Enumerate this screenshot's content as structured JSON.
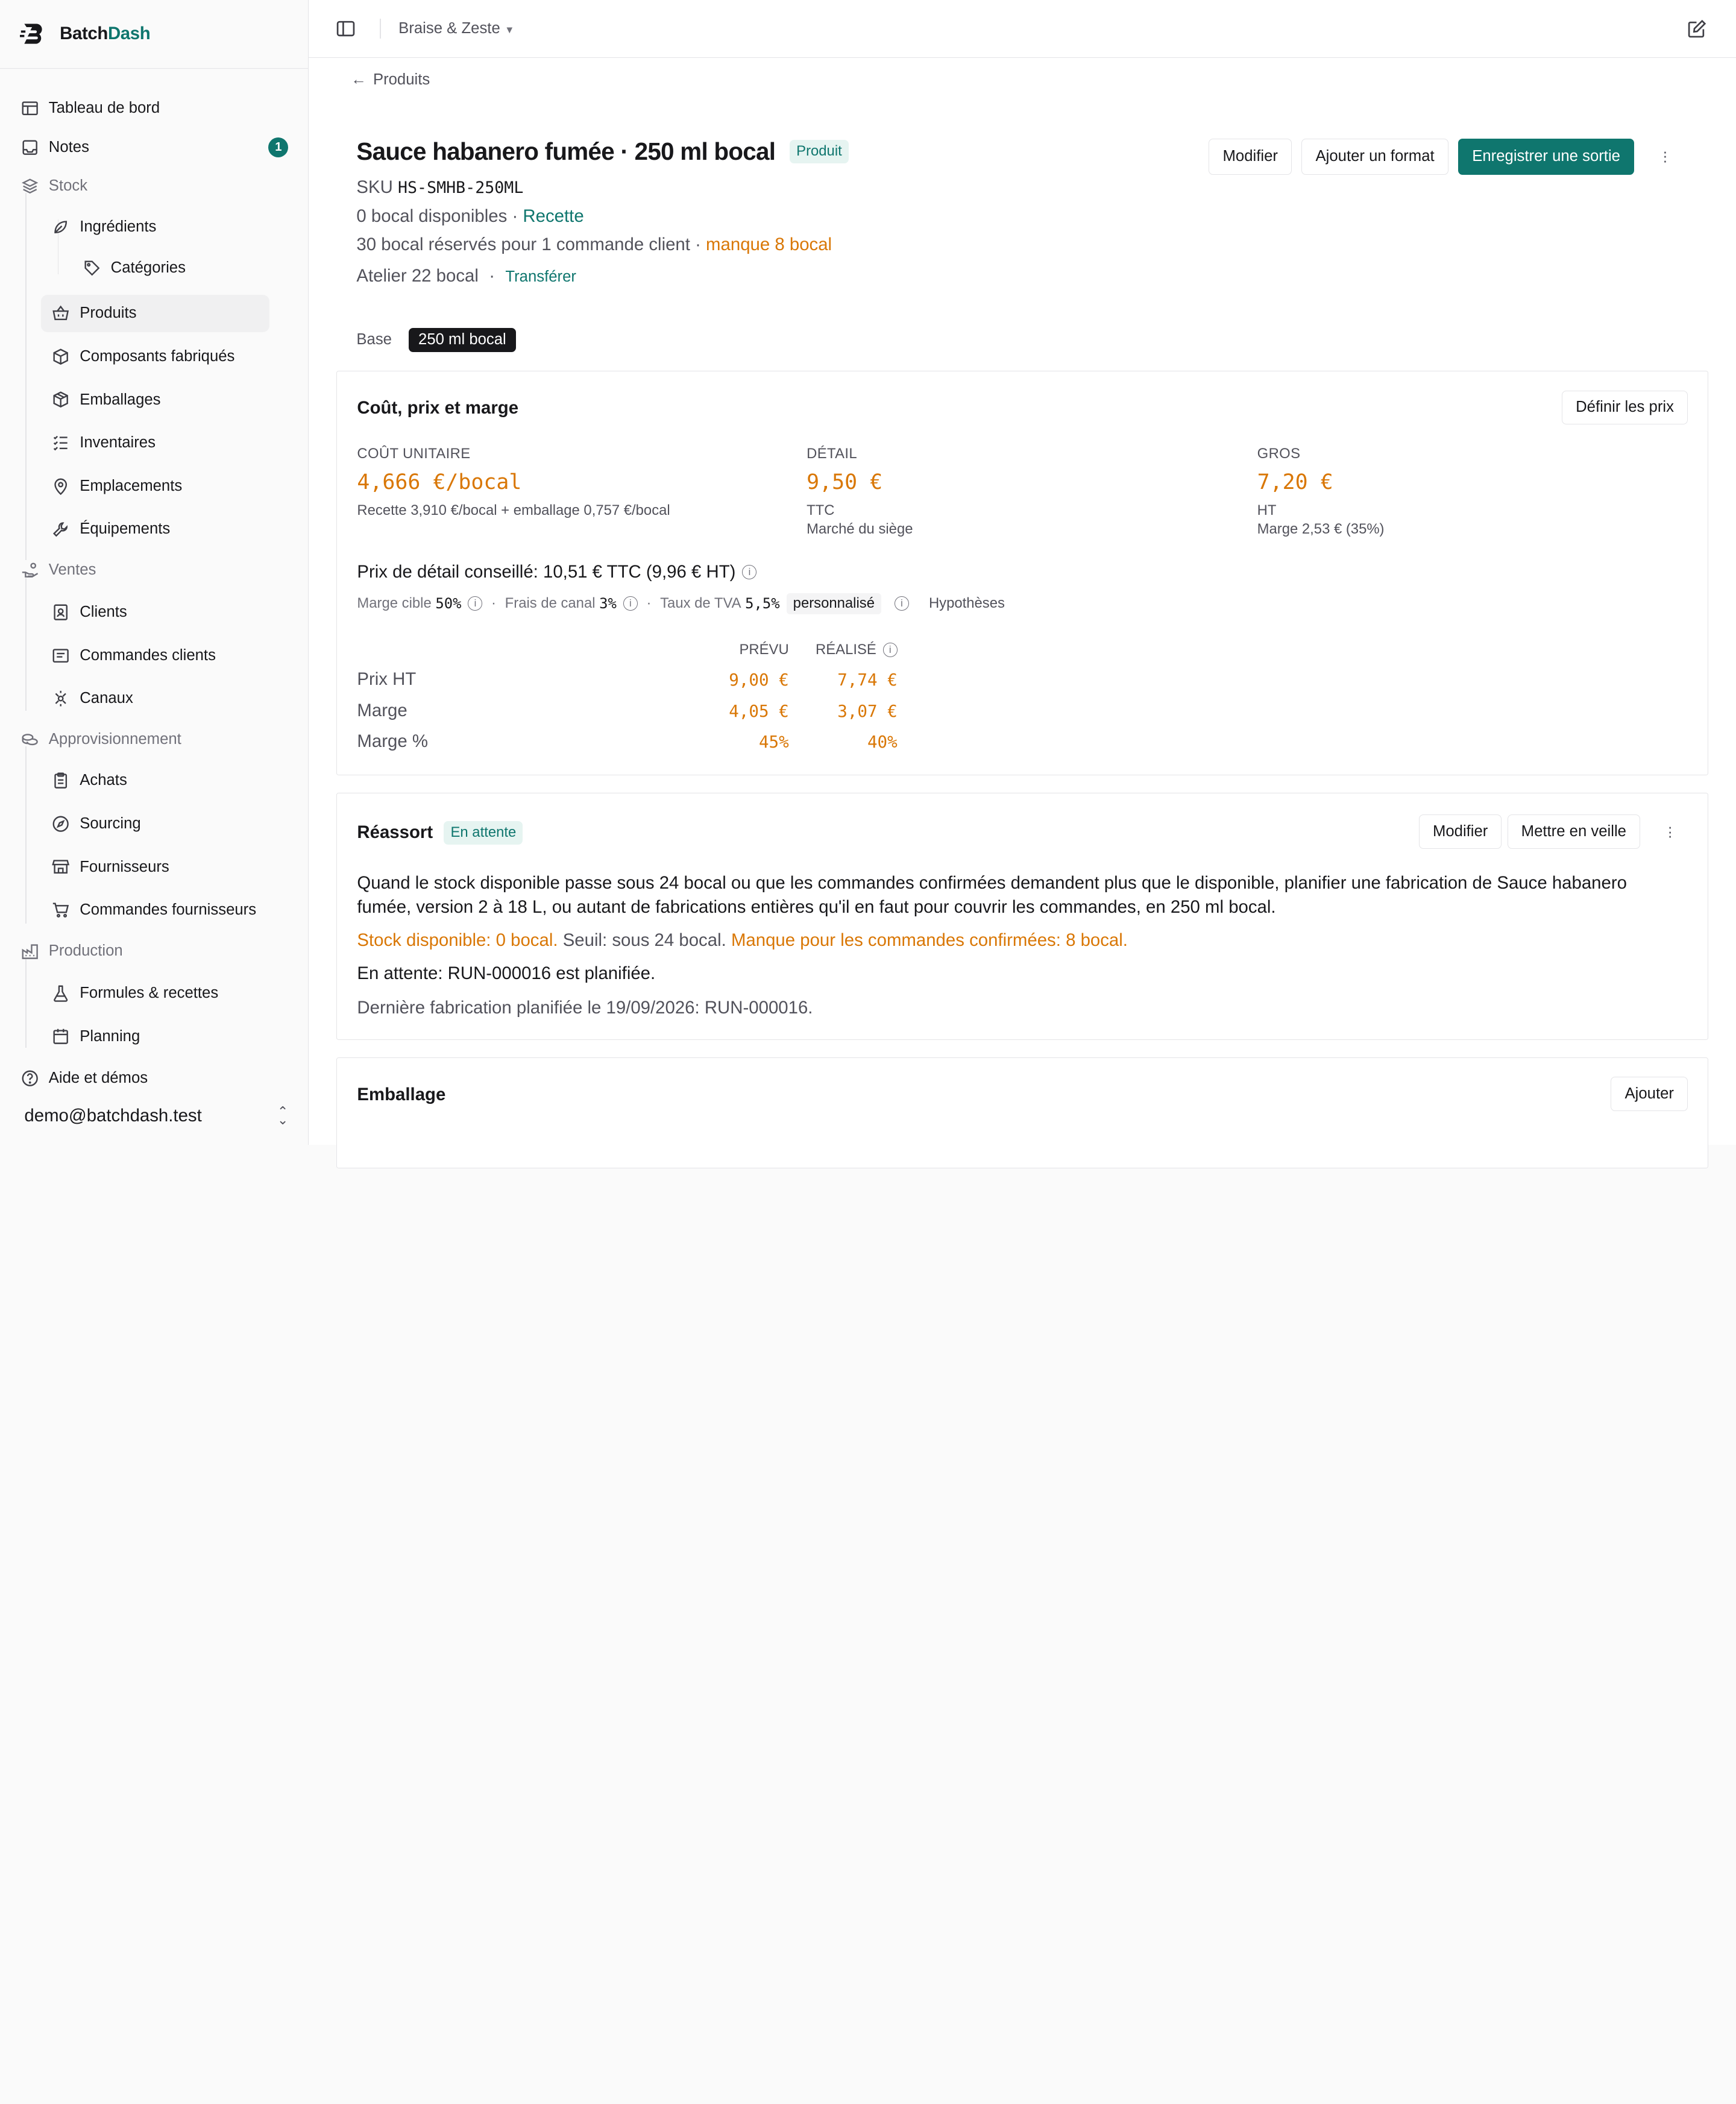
{
  "brand": {
    "name_a": "Batch",
    "name_b": "Dash"
  },
  "sidebar": {
    "items": [
      {
        "label": "Tableau de bord"
      },
      {
        "label": "Notes",
        "badge": "1"
      },
      {
        "label": "Stock"
      },
      {
        "label": "Ingrédients"
      },
      {
        "label": "Catégories"
      },
      {
        "label": "Produits"
      },
      {
        "label": "Composants fabriqués"
      },
      {
        "label": "Emballages"
      },
      {
        "label": "Inventaires"
      },
      {
        "label": "Emplacements"
      },
      {
        "label": "Équipements"
      },
      {
        "label": "Ventes"
      },
      {
        "label": "Clients"
      },
      {
        "label": "Commandes clients"
      },
      {
        "label": "Canaux"
      },
      {
        "label": "Approvisionnement"
      },
      {
        "label": "Achats"
      },
      {
        "label": "Sourcing"
      },
      {
        "label": "Fournisseurs"
      },
      {
        "label": "Commandes fournisseurs"
      },
      {
        "label": "Production"
      },
      {
        "label": "Formules & recettes"
      },
      {
        "label": "Planning"
      },
      {
        "label": "Aide et démos"
      }
    ],
    "user": "demo@batchdash.test"
  },
  "topbar": {
    "workspace": "Braise & Zeste"
  },
  "back": "Produits",
  "product": {
    "title": "Sauce habanero fumée · 250 ml bocal",
    "type_badge": "Produit",
    "sku_label": "SKU",
    "sku": "HS-SMHB-250ML",
    "available": "0 bocal disponibles",
    "available_sep": "·",
    "recipe_link": "Recette",
    "reserved": "30 bocal réservés pour 1 commande client ·",
    "shortage": "manque 8 bocal",
    "location": "Atelier 22 bocal",
    "location_sep": "·",
    "transfer": "Transférer"
  },
  "actions": {
    "edit": "Modifier",
    "add_format": "Ajouter un format",
    "record_out": "Enregistrer une sortie"
  },
  "tabs": [
    "Base",
    "250 ml bocal"
  ],
  "pricing": {
    "title": "Coût, prix et marge",
    "set_prices": "Définir les prix",
    "unit_cost_label": "COÛT UNITAIRE",
    "unit_cost": "4,666 €/bocal",
    "unit_cost_detail": "Recette 3,910 €/bocal + emballage 0,757 €/bocal",
    "retail_label": "DÉTAIL",
    "retail": "9,50 €",
    "retail_tax": "TTC",
    "retail_channel": "Marché du siège",
    "wholesale_label": "GROS",
    "wholesale": "7,20 €",
    "wholesale_tax": "HT",
    "wholesale_margin": "Marge 2,53 € (35%)",
    "suggested": "Prix de détail conseillé: 10,51 € TTC (9,96 € HT)",
    "target_margin_label": "Marge cible",
    "target_margin": "50%",
    "channel_fees_label": "Frais de canal",
    "channel_fees": "3%",
    "vat_label": "Taux de TVA",
    "vat": "5,5%",
    "vat_custom": "personnalisé",
    "assumptions": "Hypothèses",
    "col_planned": "PRÉVU",
    "col_actual": "RÉALISÉ",
    "rows": [
      {
        "label": "Prix HT",
        "planned": "9,00 €",
        "actual": "7,74 €"
      },
      {
        "label": "Marge",
        "planned": "4,05 €",
        "actual": "3,07 €"
      },
      {
        "label": "Marge %",
        "planned": "45%",
        "actual": "40%"
      }
    ]
  },
  "restock": {
    "title": "Réassort",
    "status": "En attente",
    "edit": "Modifier",
    "pause": "Mettre en veille",
    "rule": "Quand le stock disponible passe sous 24 bocal ou que les commandes confirmées demandent plus que le disponible, planifier une fabrication de Sauce habanero fumée, version 2 à 18 L, ou autant de fabrications entières qu'il en faut pour couvrir les commandes, en 250 ml bocal.",
    "stock_line": "Stock disponible: 0 bocal.",
    "threshold_line": "Seuil: sous 24 bocal.",
    "shortage_line": "Manque pour les commandes confirmées: 8 bocal.",
    "pending_line": "En attente: RUN-000016 est planifiée.",
    "last_line": "Dernière fabrication planifiée le 19/09/2026: RUN-000016."
  },
  "packaging": {
    "title": "Emballage",
    "add": "Ajouter"
  },
  "colors": {
    "accent": "#0f766e",
    "warning": "#d97706",
    "text": "#18181b",
    "muted": "#52525b"
  }
}
